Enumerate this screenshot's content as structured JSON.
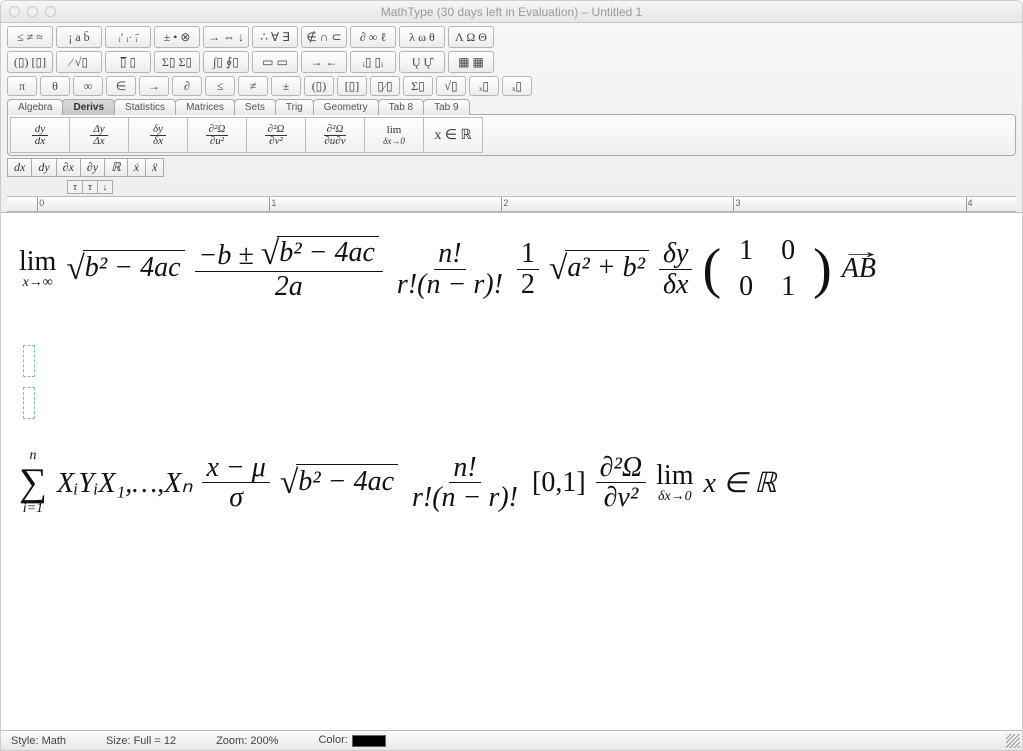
{
  "window": {
    "title": "MathType (30 days left in Evaluation) – Untitled 1"
  },
  "toolbar": {
    "row1": [
      "≤ ≠ ≈",
      "¡ a b̄",
      "ᵢ′ ᵢ· ᵢ̄",
      "± • ⊗",
      "→ ⇔ ↓",
      "∴ ∀ ∃",
      "∉ ∩ ⊂",
      "∂ ∞ ℓ",
      "λ ω θ",
      "Λ Ω Θ"
    ],
    "row2": [
      "(▯) [▯]",
      "⁄ √▯",
      "▯̅   ▯",
      "Σ▯ Σ▯",
      "∫▯ ∮▯",
      "▭ ▭",
      "→ ←",
      "ᵢ▯ ▯ᵢ",
      "Ų   Ų̂",
      "▦  ▦"
    ],
    "row3": [
      "π",
      "θ",
      "∞",
      "∈",
      "→",
      "∂",
      "≤",
      "≠",
      "±",
      "(▯)",
      "[▯]",
      "▯⁄▯",
      "Σ▯",
      "√▯",
      "ₓ▯",
      "ₓ▯"
    ]
  },
  "tabs": [
    {
      "label": "Algebra"
    },
    {
      "label": "Derivs"
    },
    {
      "label": "Statistics"
    },
    {
      "label": "Matrices"
    },
    {
      "label": "Sets"
    },
    {
      "label": "Trig"
    },
    {
      "label": "Geometry"
    },
    {
      "label": "Tab 8"
    },
    {
      "label": "Tab 9"
    }
  ],
  "activeTab": 1,
  "bigbtns": [
    {
      "num": "dy",
      "den": "dx"
    },
    {
      "num": "Δy",
      "den": "Δx"
    },
    {
      "num": "δy",
      "den": "δx"
    },
    {
      "num": "∂²Ω",
      "den": "∂u²"
    },
    {
      "num": "∂²Ω",
      "den": "∂v²"
    },
    {
      "num": "∂²Ω",
      "den": "∂u∂v"
    },
    {
      "limTop": "lim",
      "limSub": "δx→0"
    },
    {
      "plain": "x ∈ ℝ"
    }
  ],
  "minibtns": [
    "dx",
    "dy",
    "∂x",
    "∂y",
    "ℝ",
    "ẋ",
    "ẍ"
  ],
  "tinybtns": [
    "τ",
    "τ",
    "↓"
  ],
  "ruler": [
    "0",
    "1",
    "2",
    "3",
    "4"
  ],
  "equations": {
    "line1": {
      "lim_sub": "x→∞",
      "sqrt1": "b² − 4ac",
      "frac1_num_pre": "−b ± ",
      "frac1_num_sqrt": "b² − 4ac",
      "frac1_den": "2a",
      "frac2_num": "n!",
      "frac2_den": "r!(n − r)!",
      "frac3_num": "1",
      "frac3_den": "2",
      "sqrt2": "a² + b²",
      "frac4_num": "δy",
      "frac4_den": "δx",
      "matrix": [
        [
          "1",
          "0"
        ],
        [
          "0",
          "1"
        ]
      ],
      "vec": "AB"
    },
    "line2": {
      "sum_top": "n",
      "sum_bot": "i=1",
      "seq": "XᵢYᵢX₁,…,Xₙ",
      "frac1_num": "x − μ",
      "frac1_den": "σ",
      "sqrt": "b² − 4ac",
      "frac2_num": "n!",
      "frac2_den": "r!(n − r)!",
      "interval": "[0,1]",
      "partial_num": "∂²Ω",
      "partial_den": "∂v²",
      "lim_sub": "δx→0",
      "tail": "x ∈ ℝ"
    }
  },
  "status": {
    "style_label": "Style:",
    "style_val": "Math",
    "size_label": "Size:",
    "size_val": "Full = 12",
    "zoom_label": "Zoom:",
    "zoom_val": "200%",
    "color_label": "Color:"
  }
}
